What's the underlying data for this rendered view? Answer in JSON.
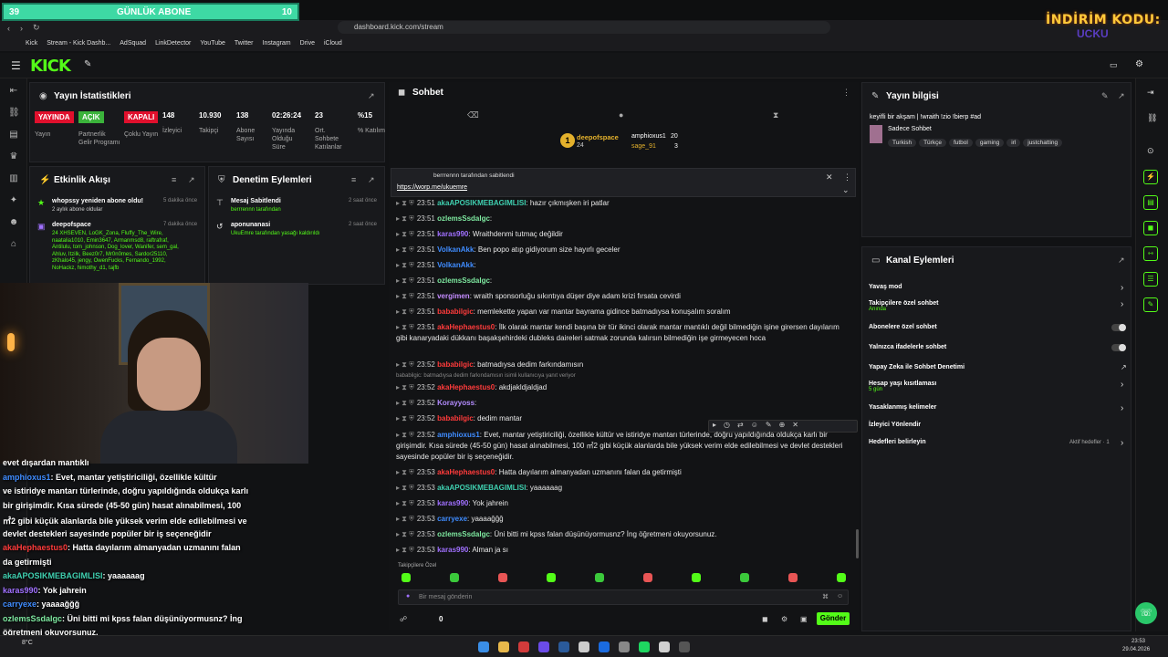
{
  "overlay_top": {
    "left": "39",
    "center": "GÜNLÜK ABONE",
    "right": "10"
  },
  "browser": {
    "url": "dashboard.kick.com/stream",
    "bookmarks": [
      "Kick",
      "Stream - Kick Dashb...",
      "AdSquad",
      "LinkDetector",
      "YouTube",
      "Twitter",
      "Instagram",
      "Drive",
      "iCloud"
    ]
  },
  "promo": {
    "line1": "İNDİRİM KODU:",
    "line2": "UCKU"
  },
  "stats": {
    "title": "Yayın İstatistikleri",
    "items": [
      {
        "value": "YAYINDA",
        "label": "Yayın",
        "color": "#e0102d"
      },
      {
        "value": "AÇIK",
        "label": "Partnerlik Gelir Programı",
        "color": "#3bb33b"
      },
      {
        "value": "KAPALI",
        "label": "Çoklu Yayın",
        "color": "#e0102d"
      },
      {
        "value": "148",
        "label": "İzleyici"
      },
      {
        "value": "10.930",
        "label": "Takipçi"
      },
      {
        "value": "138",
        "label": "Abone Sayısı"
      },
      {
        "value": "02:26:24",
        "label": "Yayında Olduğu Süre"
      },
      {
        "value": "23",
        "label": "Ort. Sohbete Katılanlar"
      },
      {
        "value": "%15",
        "label": "% Katılım"
      }
    ]
  },
  "activity": {
    "title": "Etkinlik Akışı",
    "items": [
      {
        "text": "whopssy yeniden abone oldu!",
        "sub": "2 aylık abone oldular",
        "time": "5 dakika önce"
      },
      {
        "text": "deepofspace",
        "sub": "24 XHSEVEN, LoGK_Zona, Fluffy_The_Wire, naatalia1010, Emin3647, Armanmsd8, raftrafraf, Antilulu, tom_johnson, Dog_lover, Wanifer, sem_gal, Ahluv, Itzilk, Beez0r7, Mr0n0mes, Sardor25110, zKhalo45, jengy, OwenFucks, Fernando_1992, NoHackz, himothy_d1, tajfb",
        "time": "7 dakika önce"
      }
    ]
  },
  "moderation": {
    "title": "Denetim Eylemleri",
    "items": [
      {
        "text": "Mesaj Sabitlendi",
        "sub": "berrrennn tarafından",
        "time": "2 saat önce"
      },
      {
        "text": "aponunanasi",
        "sub": "UkuEmre tarafından yasağı kaldırıldı",
        "time": "2 saat önce"
      }
    ]
  },
  "chat": {
    "title": "Sohbet",
    "gifts": {
      "top": "deepofspace",
      "top_count": "24",
      "second": "amphioxus1",
      "second_count": "20",
      "third": "sage_91",
      "third_count": "3"
    },
    "pinned": {
      "by": "berrrennn tarafından sabitlendi",
      "link": "https://worp.me/ukuemre"
    },
    "messages": [
      {
        "time": "23:51",
        "user": "akaAPOSIKMEBAGIMLISI",
        "color": "#3fd0b0",
        "text": ": hazır çıkmışken iri patlar"
      },
      {
        "time": "23:51",
        "user": "ozlemsSsdalgc",
        "color": "#7ee9a0",
        "text": ":"
      },
      {
        "time": "23:51",
        "user": "karas990",
        "color": "#a070ff",
        "text": ": Wraithdenmi tutmaç değildir"
      },
      {
        "time": "23:51",
        "user": "VolkanAkk",
        "color": "#3f8cff",
        "text": ": Ben popo atıp gidiyorum size hayırlı geceler"
      },
      {
        "time": "23:51",
        "user": "VolkanAkk",
        "color": "#3f8cff",
        "text": ":"
      },
      {
        "time": "23:51",
        "user": "ozlemsSsdalgc",
        "color": "#7ee9a0",
        "text": ":"
      },
      {
        "time": "23:51",
        "user": "vergimen",
        "color": "#c48cff",
        "text": ": wraith sponsorluğu sıkıntıya düşer diye adam krizi fırsata cevirdi"
      },
      {
        "time": "23:51",
        "user": "bababilgic",
        "color": "#ff3b3b",
        "text": ": memlekette yapan var mantar bayrama gidince batmadıysa konuşalım soralım"
      },
      {
        "time": "23:51",
        "user": "akaHephaestus0",
        "color": "#ff3b3b",
        "text": ": İlk olarak mantar kendi başına bir tür ikinci olarak mantar mantıklı değil bilmediğin işine girersen dayılarım gibi kanaryadaki dükkanı başakşehirdeki dubleks daireleri satmak zorunda kalırsın bilmediğin işe girmeyecen hoca"
      },
      {
        "time": "23:52",
        "user": "bababilgic",
        "color": "#ff3b3b",
        "text": ": batmadıysa dedim farkındamısın"
      },
      {
        "time": "23:52",
        "user": "akaHephaestus0",
        "color": "#ff3b3b",
        "text": ": akdjakldjaldjad"
      },
      {
        "time": "23:52",
        "user": "Korayyoss",
        "color": "#b48cff",
        "text": ":"
      },
      {
        "time": "23:52",
        "user": "bababilgic",
        "color": "#ff3b3b",
        "text": ": dedim mantar"
      },
      {
        "time": "23:52",
        "user": "amphioxus1",
        "color": "#3f8cff",
        "text": ": Evet, mantar yetiştiriciliği, özellikle kültür ve istiridye mantarı türlerinde, doğru yapıldığında oldukça karlı bir girişimdir. Kısa sürede (45-50 gün) hasat alınabilmesi, 100 ㎡2 gibi küçük alanlarda bile yüksek verim elde edilebilmesi ve devlet destekleri sayesinde popüler bir iş seçeneğidir."
      },
      {
        "time": "23:53",
        "user": "akaHephaestus0",
        "color": "#ff3b3b",
        "text": ": Hatta dayılarım almanyadan uzmanını falan da getirmişti"
      },
      {
        "time": "23:53",
        "user": "akaAPOSIKMEBAGIMLISI",
        "color": "#3fd0b0",
        "text": ": yaaaaaag"
      },
      {
        "time": "23:53",
        "user": "karas990",
        "color": "#a070ff",
        "text": ": Yok jahrein"
      },
      {
        "time": "23:53",
        "user": "carryexe",
        "color": "#3f8cff",
        "text": ": yaaaağğğ"
      },
      {
        "time": "23:53",
        "user": "ozlemsSsdalgc",
        "color": "#7ee9a0",
        "text": ": Üni bitti mi kpss falan düşünüyormusnz? İng öğretmeni okuyorsunuz."
      },
      {
        "time": "23:53",
        "user": "karas990",
        "color": "#a070ff",
        "text": ": Alman ja sı"
      }
    ],
    "reply_hint": "bababilgic: batmadıysa dedim farkındamısın isimli kullanıcıya yanıt veriyor",
    "followers_label": "Takipçilere Özel",
    "placeholder": "Bir mesaj gönderin",
    "count": "0",
    "send": "Gönder"
  },
  "info": {
    "title": "Yayın bilgisi",
    "stream_title": "keyifli bir akşam | !wraith !zio !bierp #ad",
    "category": "Sadece Sohbet",
    "tags": [
      "Turkish",
      "Türkçe",
      "futbol",
      "gaming",
      "irl",
      "justchatting"
    ]
  },
  "channel": {
    "title": "Kanal Eylemleri",
    "rows": [
      {
        "label": "Yavaş mod",
        "kind": "chev"
      },
      {
        "label": "Takipçilere özel sohbet",
        "sub": "Anında",
        "kind": "chev"
      },
      {
        "label": "Abonelere özel sohbet",
        "kind": "toggle"
      },
      {
        "label": "Yalnızca ifadelerle sohbet",
        "kind": "toggle"
      },
      {
        "label": "Yapay Zeka ile Sohbet Denetimi",
        "kind": "ext"
      },
      {
        "label": "Hesap yaşı kısıtlaması",
        "sub": "5 gün",
        "kind": "chev"
      },
      {
        "label": "Yasaklanmış kelimeler",
        "kind": "chev"
      },
      {
        "label": "İzleyici Yönlendir",
        "kind": "none"
      },
      {
        "label": "Hedefleri belirleyin",
        "sub_right": "Aktif hedefler · 1",
        "kind": "chev"
      }
    ]
  },
  "overlay_chat": [
    {
      "user": "",
      "text": "evet dışardan mantıklı",
      "color": "#fff"
    },
    {
      "user": "amphioxus1",
      "text": ": Evet, mantar yetiştiriciliği, özellikle kültür",
      "color": "#3f8cff"
    },
    {
      "user": "",
      "text": "ve istiridye mantarı türlerinde, doğru yapıldığında oldukça karlı",
      "color": "#fff"
    },
    {
      "user": "",
      "text": "bir girişimdir. Kısa sürede (45-50 gün) hasat alınabilmesi, 100",
      "color": "#fff"
    },
    {
      "user": "",
      "text": "㎡2 gibi küçük alanlarda bile yüksek verim elde edilebilmesi ve",
      "color": "#fff"
    },
    {
      "user": "",
      "text": "devlet destekleri sayesinde popüler bir iş seçeneğidir",
      "color": "#fff"
    },
    {
      "user": "akaHephaestus0",
      "text": ": Hatta dayılarım almanyadan uzmanını falan",
      "color": "#ff3b3b"
    },
    {
      "user": "",
      "text": "da getirmişti",
      "color": "#fff"
    },
    {
      "user": "akaAPOSIKMEBAGIMLISI",
      "text": ": yaaaaaag",
      "color": "#3fd0b0"
    },
    {
      "user": "karas990",
      "text": ": Yok jahrein",
      "color": "#a070ff"
    },
    {
      "user": "carryexe",
      "text": ": yaaaağğğ",
      "color": "#3f8cff"
    },
    {
      "user": "ozlemsSsdalgc",
      "text": ": Üni bitti mi kpss falan düşünüyormusnz? İng",
      "color": "#7ee9a0"
    },
    {
      "user": "",
      "text": "öğretmeni okuyorsunuz.",
      "color": "#fff"
    },
    {
      "user": "karas990",
      "text": ": Alman ja sı",
      "color": "#a070ff"
    }
  ],
  "taskbar": {
    "time": "23:53",
    "date": "29.04.2026",
    "weather": "8°C"
  }
}
